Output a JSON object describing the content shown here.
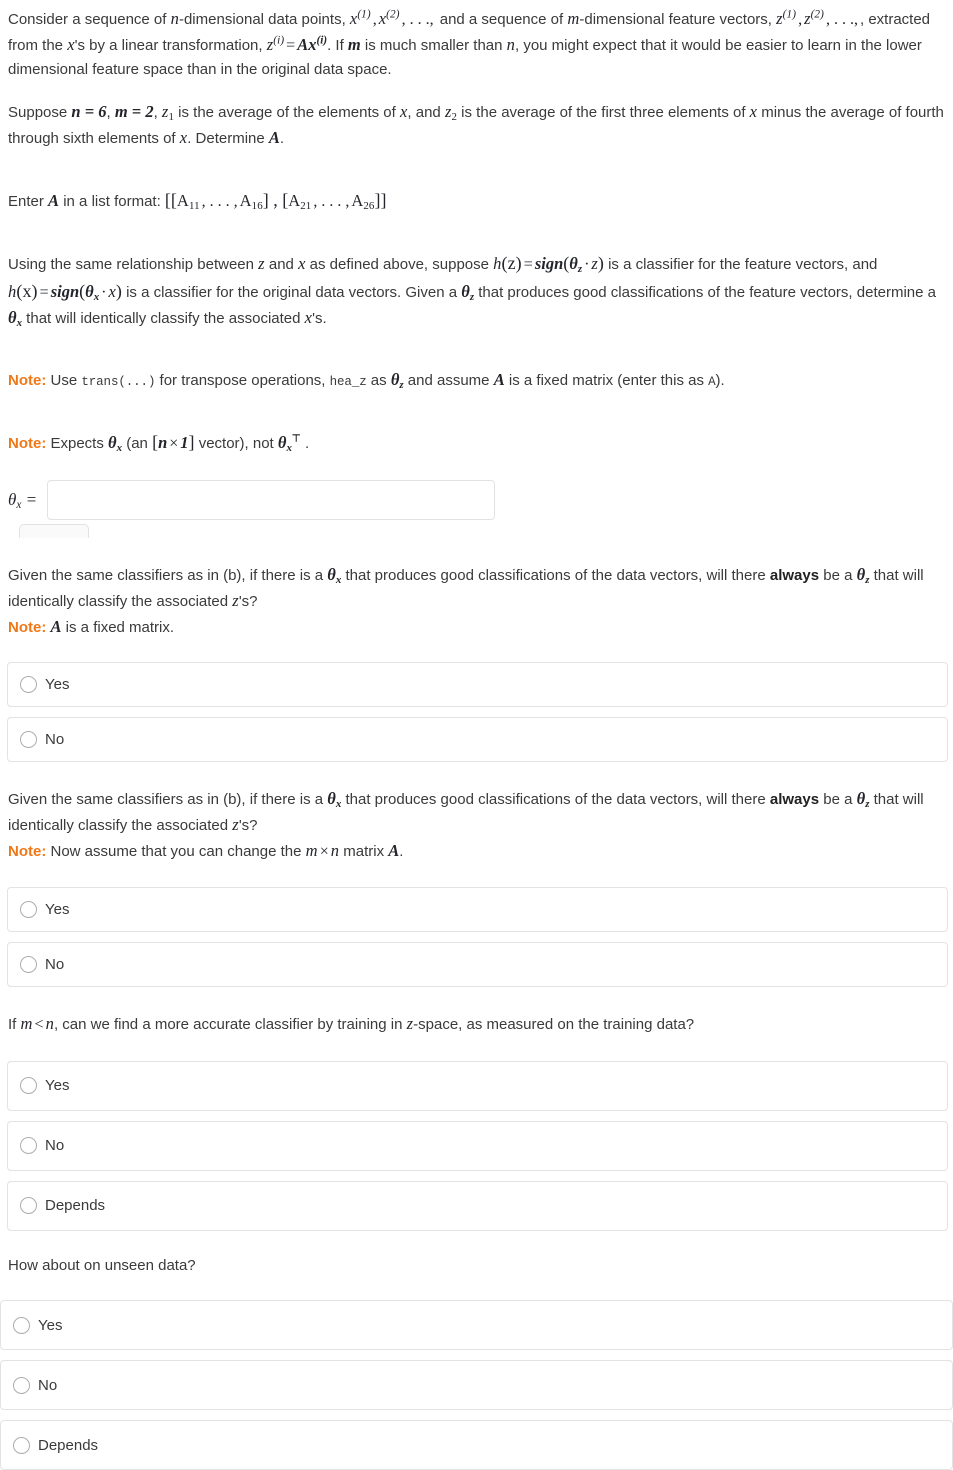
{
  "intro": {
    "line1_a": "Consider a sequence of ",
    "line1_n": "n",
    "line1_b": "-dimensional data points, ",
    "x1": "x",
    "x1_sup": "(1)",
    "x2": "x",
    "x2_sup": "(2)",
    "ellipsis": ", . . .,",
    "line1_c": " and a sequence of ",
    "line1_m": "m",
    "line1_d": "-dimensional feature vectors,",
    "z1": "z",
    "z1_sup": "(1)",
    "z2": "z",
    "z2_sup": "(2)",
    "line2_a": ", extracted from the ",
    "line2_x": "x",
    "line2_b": "'s by a linear transformation, ",
    "zi": "z",
    "zi_sup": "(i)",
    "eq": "=",
    "A": "A",
    "xi": "x",
    "xi_sup": "(i)",
    "line2_c": ". If ",
    "line2_m": "m",
    "line2_d": " is much smaller than ",
    "line2_n": "n",
    "line2_e": ", you might expect that it would be easier to learn in the lower dimensional feature space than in the original data space."
  },
  "suppose": {
    "a": "Suppose ",
    "n_eq": "n = 6",
    "comma1": ", ",
    "m_eq": "m = 2",
    "comma2": ", ",
    "z1": "z",
    "z1_sub": "1",
    "b": " is the average of the elements of ",
    "x1": "x",
    "c": ", and ",
    "z2": "z",
    "z2_sub": "2",
    "d": " is the average of the first three elements of ",
    "x2": "x",
    "e": " minus the average of fourth through sixth elements of ",
    "x3": "x",
    "f": ". Determine ",
    "A": "A",
    "g": "."
  },
  "enter_format": {
    "a": "Enter ",
    "A": "A",
    "b": " in a list format: ",
    "open": "[[",
    "A11": "A",
    "A11_sub": "11",
    "dots1": ", . . . ,",
    "A16": "A",
    "A16_sub": "16",
    "mid": "] , [",
    "A21": "A",
    "A21_sub": "21",
    "dots2": ", . . . ,",
    "A26": "A",
    "A26_sub": "26",
    "close": "]]"
  },
  "classifier_para": {
    "a": "Using the same relationship between ",
    "z": "z",
    "b": " and ",
    "x": "x",
    "c": " as defined above, suppose ",
    "hz": "h",
    "hz_arg": "(z)",
    "hz_eq": "=",
    "hz_sign": "sign",
    "hz_inner_open": "(",
    "hz_theta": "θ",
    "hz_theta_sub": "z",
    "hz_dot": "·",
    "hz_var": "z",
    "hz_inner_close": ")",
    "d": " is a classifier for the feature vectors, and ",
    "hx": "h",
    "hx_arg": "(x)",
    "hx_eq": "=",
    "hx_sign": "sign",
    "hx_inner_open": "(",
    "hx_theta": "θ",
    "hx_theta_sub": "x",
    "hx_dot": "·",
    "hx_var": "x",
    "hx_inner_close": ")",
    "e": " is a classifier for the original data vectors. Given a ",
    "theta_z": "θ",
    "theta_z_sub": "z",
    "f": " that produces good classifications of the feature vectors, determine a ",
    "theta_x": "θ",
    "theta_x_sub": "x",
    "g": " that will identically classify the associated ",
    "x_end": "x",
    "h": "'s."
  },
  "note1": {
    "label": "Note:",
    "a": " Use ",
    "trans": "trans(...)",
    "b": " for transpose operations, ",
    "hea_z": "hea_z",
    "c": " as ",
    "theta": "θ",
    "theta_sub": "z",
    "d": " and assume ",
    "A": "A",
    "e": " is a fixed matrix (enter this as ",
    "a_mono": "A",
    "f": ")."
  },
  "note2": {
    "label": "Note:",
    "a": " Expects ",
    "theta": "θ",
    "theta_sub": "x",
    "b": " (an ",
    "dim_open": "[",
    "dim_n": "n",
    "dim_times": "×",
    "dim_one": "1",
    "dim_close": "]",
    "c": " vector), not ",
    "theta2": "θ",
    "theta2_sub": "x",
    "theta2_tpose": "⊤",
    "d": " ."
  },
  "answer": {
    "label_theta": "θ",
    "label_sub": "x",
    "label_eq": " =",
    "value": "",
    "placeholder": ""
  },
  "q1": {
    "a": "Given the same classifiers as in (b), if there is a ",
    "theta_x": "θ",
    "theta_x_sub": "x",
    "b": " that produces good classifications of the data vectors, will there ",
    "always": "always",
    "c": " be a ",
    "theta_z": "θ",
    "theta_z_sub": "z",
    "d": " that will identically classify the associated ",
    "z": "z",
    "e": "'s?",
    "note_label": "Note:",
    "note_a": " ",
    "note_A": "A",
    "note_b": " is a fixed matrix.",
    "options": [
      "Yes",
      "No"
    ]
  },
  "q2": {
    "a": "Given the same classifiers as in (b), if there is a ",
    "theta_x": "θ",
    "theta_x_sub": "x",
    "b": " that produces good classifications of the data vectors, will there ",
    "always": "always",
    "c": " be a ",
    "theta_z": "θ",
    "theta_z_sub": "z",
    "d": " that will identically classify the associated ",
    "z": "z",
    "e": "'s?",
    "note_label": "Note:",
    "note_a": " Now assume that you can change the ",
    "note_m": "m",
    "note_times": "×",
    "note_n": "n",
    "note_b": " matrix ",
    "note_A": "A",
    "note_c": ".",
    "options": [
      "Yes",
      "No"
    ]
  },
  "q3": {
    "a": "If ",
    "m": "m",
    "lt": "<",
    "n": "n",
    "b": ", can we find a more accurate classifier by training in ",
    "z": "z",
    "c": "-space, as measured on the training data?",
    "options": [
      "Yes",
      "No",
      "Depends"
    ]
  },
  "q4": {
    "text": "How about on unseen data?",
    "options": [
      "Yes",
      "No",
      "Depends"
    ]
  },
  "colors": {
    "note_orange": "#f07818",
    "body_text": "#3a3a3a",
    "math_text": "#23252b",
    "border": "#e3e3e3",
    "radio_border": "#adadad"
  }
}
